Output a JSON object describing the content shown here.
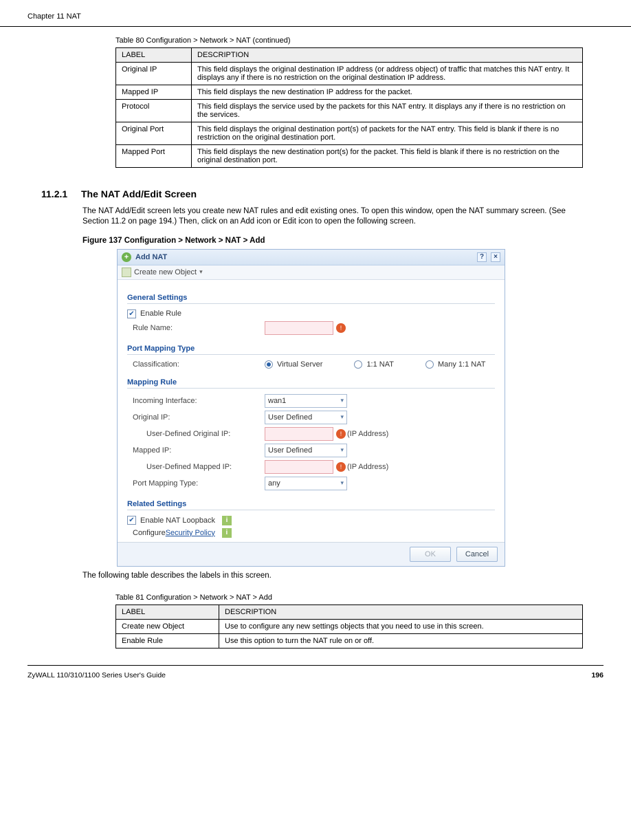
{
  "header": {
    "left": "Chapter 11 NAT"
  },
  "table1": {
    "caption": "Table 80   Configuration > Network > NAT (continued)",
    "head": [
      "LABEL",
      "DESCRIPTION"
    ],
    "rows": [
      [
        "Original IP",
        "This field displays the original destination IP address (or address object) of traffic that matches this NAT entry. It displays any if there is no restriction on the original destination IP address."
      ],
      [
        "Mapped IP",
        "This field displays the new destination IP address for the packet."
      ],
      [
        "Protocol",
        "This field displays the service used by the packets for this NAT entry. It displays any if there is no restriction on the services."
      ],
      [
        "Original Port",
        "This field displays the original destination port(s) of packets for the NAT entry. This field is blank if there is no restriction on the original destination port."
      ],
      [
        "Mapped Port",
        "This field displays the new destination port(s) for the packet. This field is blank if there is no restriction on the original destination port."
      ]
    ]
  },
  "section": {
    "num": "11.2.1",
    "title": "The NAT Add/Edit Screen",
    "p1": "The NAT Add/Edit screen lets you create new NAT rules and edit existing ones. To open this window, open the NAT summary screen. (See Section 11.2 on page 194.) Then, click on an Add icon or Edit icon to open the following screen."
  },
  "figure": {
    "caption": "Figure 137   Configuration > Network > NAT > Add"
  },
  "dialog": {
    "title": "Add NAT",
    "toolbar": {
      "label": "Create new Object"
    },
    "section_general": "General Settings",
    "enable_rule": "Enable Rule",
    "rule_name": "Rule Name:",
    "section_pmt": "Port Mapping Type",
    "classification": "Classification:",
    "radios": {
      "vs": "Virtual Server",
      "one": "1:1 NAT",
      "many": "Many 1:1 NAT"
    },
    "section_mapping": "Mapping Rule",
    "incoming_if": "Incoming Interface:",
    "incoming_if_val": "wan1",
    "original_ip": "Original IP:",
    "original_ip_val": "User Defined",
    "ud_original_ip": "User-Defined Original IP:",
    "mapped_ip": "Mapped IP:",
    "mapped_ip_val": "User Defined",
    "ud_mapped_ip": "User-Defined Mapped IP:",
    "port_mapping_type": "Port Mapping Type:",
    "port_mapping_type_val": "any",
    "ip_hint": "(IP Address)",
    "section_related": "Related Settings",
    "enable_loopback": "Enable NAT Loopback",
    "configure": "Configure ",
    "security_policy": "Security Policy",
    "ok": "OK",
    "cancel": "Cancel"
  },
  "descIntro": "The following table describes the labels in this screen.",
  "table2": {
    "caption": "Table 81   Configuration > Network > NAT > Add",
    "head": [
      "LABEL",
      "DESCRIPTION"
    ],
    "rows": [
      [
        "Create new Object",
        "Use to configure any new settings objects that you need to use in this screen."
      ],
      [
        "Enable Rule",
        "Use this option to turn the NAT rule on or off."
      ]
    ]
  },
  "footer": {
    "left": "ZyWALL 110/310/1100 Series User's Guide",
    "page": "196"
  }
}
